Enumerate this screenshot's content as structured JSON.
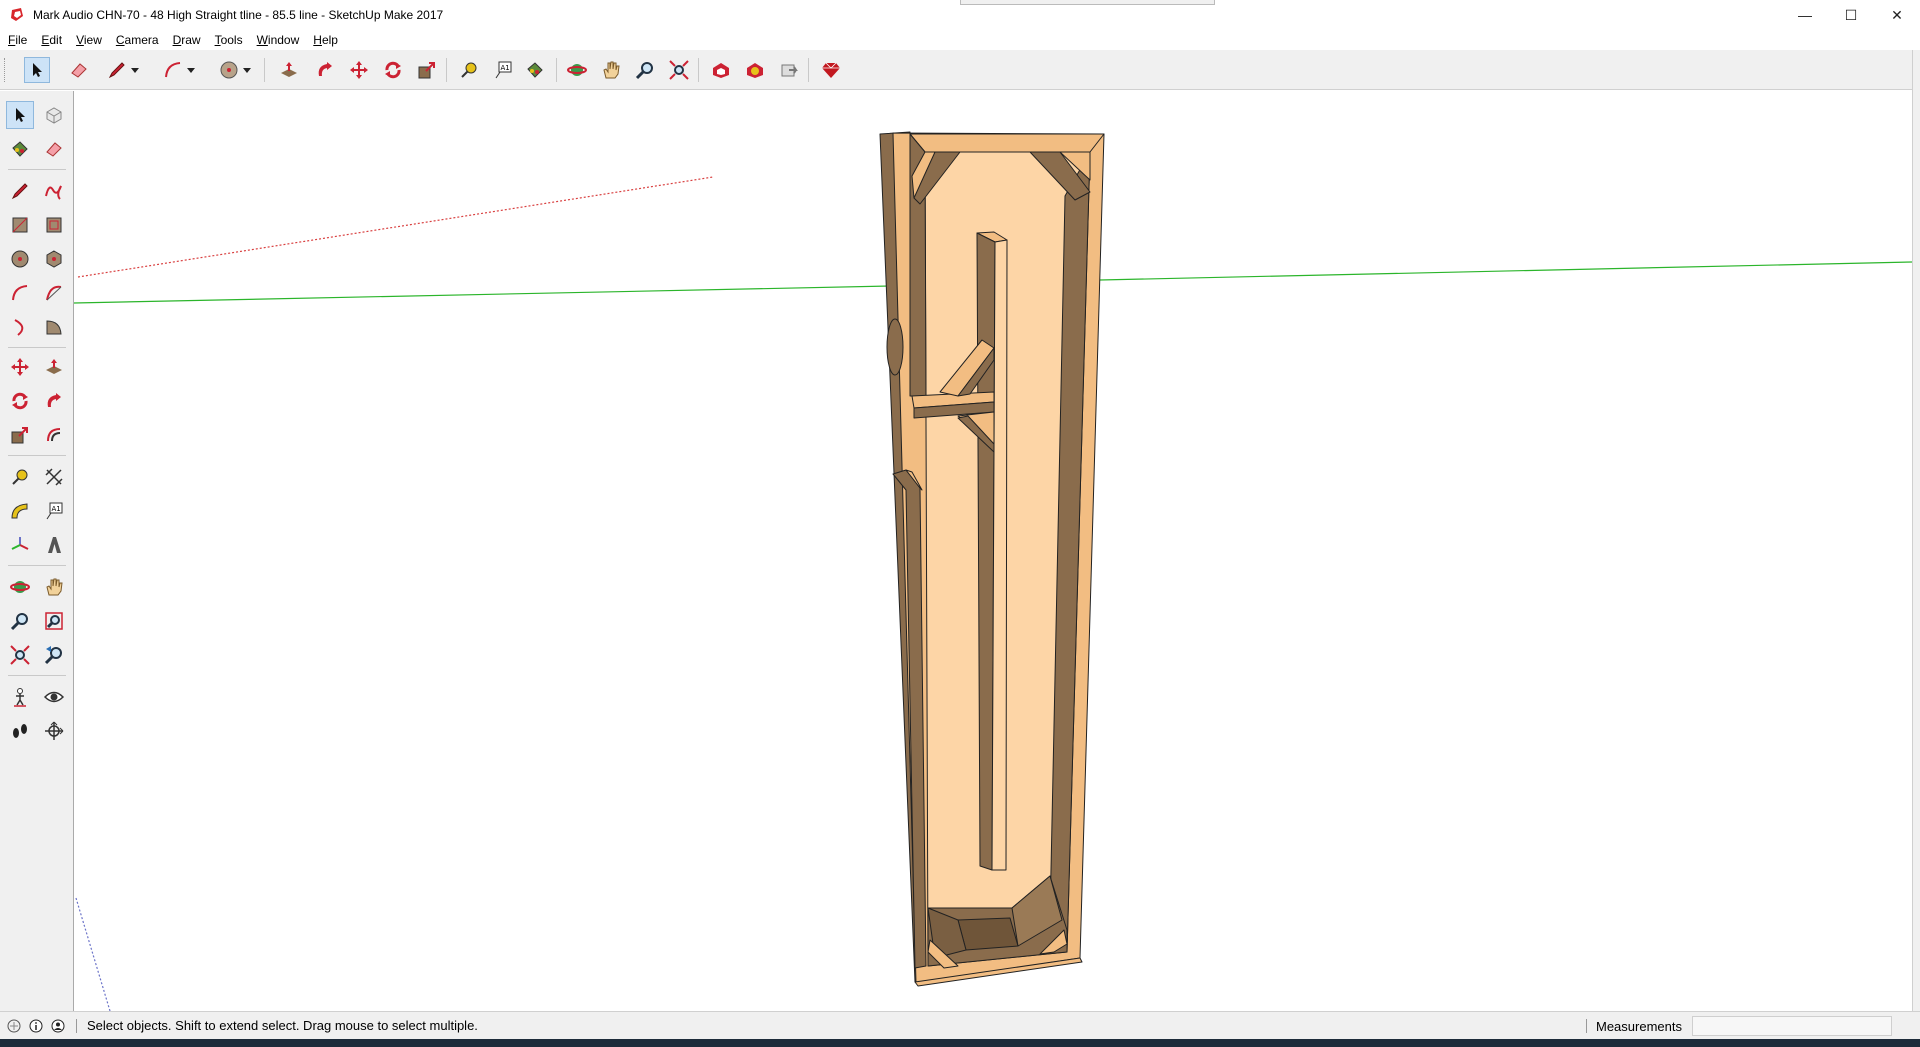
{
  "window": {
    "title": "Mark Audio CHN-70 - 48 High Straight tline - 85.5 line - SketchUp Make 2017",
    "controls": {
      "minimize": "—",
      "maximize": "☐",
      "close": "✕"
    }
  },
  "menu": [
    {
      "name": "menu-file",
      "label": "File"
    },
    {
      "name": "menu-edit",
      "label": "Edit"
    },
    {
      "name": "menu-view",
      "label": "View"
    },
    {
      "name": "menu-camera",
      "label": "Camera"
    },
    {
      "name": "menu-draw",
      "label": "Draw"
    },
    {
      "name": "menu-tools",
      "label": "Tools"
    },
    {
      "name": "menu-window",
      "label": "Window"
    },
    {
      "name": "menu-help",
      "label": "Help"
    }
  ],
  "tools": {
    "top": [
      "select",
      "eraser",
      "line",
      "line-dropdown",
      "arc",
      "arc-dropdown",
      "circle",
      "circle-dropdown",
      "push-pull",
      "follow-me",
      "move",
      "rotate",
      "scale",
      "tape-measure",
      "text",
      "paint-bucket",
      "orbit",
      "pan",
      "zoom",
      "zoom-extents",
      "warehouse",
      "extension-warehouse",
      "share-model",
      "extension-ruby"
    ],
    "left": [
      "select",
      "make-component",
      "paint-bucket",
      "eraser",
      "line",
      "freehand",
      "rectangle",
      "rotated-rectangle",
      "circle",
      "polygon",
      "arc",
      "two-point-arc",
      "three-point-arc",
      "pie",
      "move",
      "push-pull",
      "rotate",
      "follow-me",
      "scale",
      "offset",
      "tape-measure",
      "dimension",
      "protractor",
      "text",
      "axes",
      "3d-text",
      "orbit",
      "pan",
      "zoom",
      "zoom-window",
      "zoom-extents",
      "previous-view",
      "position-camera",
      "look-around",
      "walk",
      "section-plane"
    ]
  },
  "status": {
    "hint": "Select objects. Shift to extend select. Drag mouse to select multiple.",
    "measurements_label": "Measurements",
    "measurements_value": ""
  },
  "colors": {
    "wood_light": "#fdd5a6",
    "wood_mid": "#f2bd82",
    "wood_shadow": "#8a6c4c",
    "axis_green": "#2bb52b",
    "axis_red": "#d94040",
    "axis_blue": "#6a72c8",
    "selection_blue": "#cde3f7"
  }
}
